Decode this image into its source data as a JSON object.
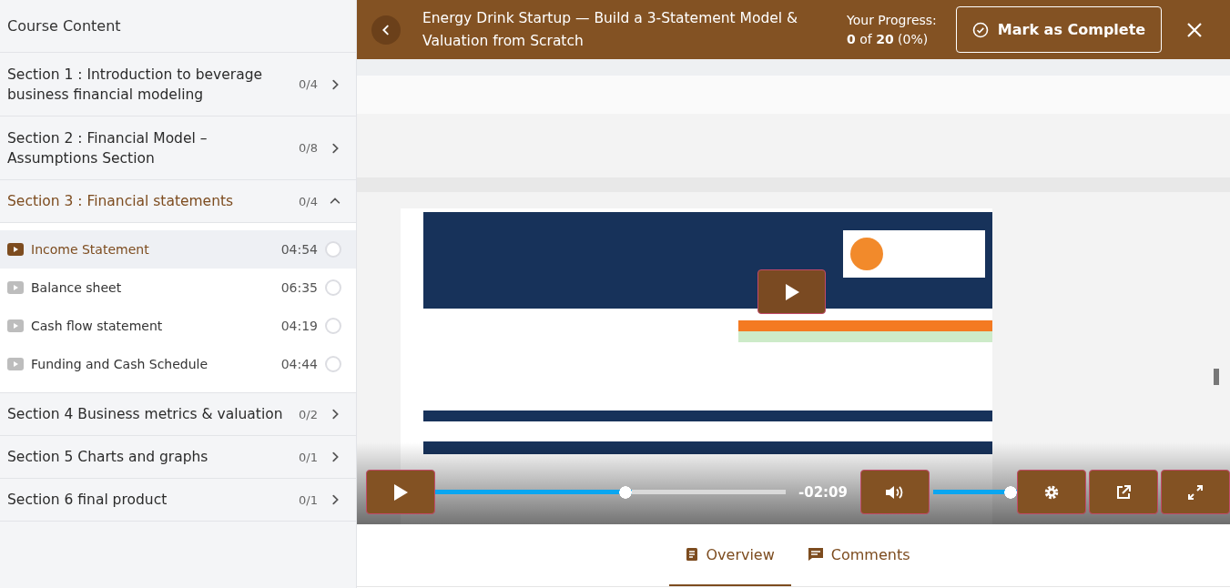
{
  "sidebar": {
    "title": "Course Content",
    "sections": [
      {
        "title": "Section 1 : Introduction to beverage business financial modeling",
        "count": "0/4",
        "expanded": false
      },
      {
        "title": "Section 2 : Financial Model – Assumptions Section",
        "count": "0/8",
        "expanded": false
      },
      {
        "title": "Section 3 : Financial statements",
        "count": "0/4",
        "expanded": true,
        "lessons": [
          {
            "title": "Income Statement",
            "duration": "04:54",
            "selected": true,
            "completed": false
          },
          {
            "title": "Balance sheet",
            "duration": "06:35",
            "selected": false,
            "completed": false
          },
          {
            "title": "Cash flow statement",
            "duration": "04:19",
            "selected": false,
            "completed": false
          },
          {
            "title": "Funding and Cash Schedule",
            "duration": "04:44",
            "selected": false,
            "completed": false
          }
        ]
      },
      {
        "title": "Section 4 Business metrics & valuation",
        "count": "0/2",
        "expanded": false
      },
      {
        "title": "Section 5 Charts and graphs",
        "count": "0/1",
        "expanded": false
      },
      {
        "title": "Section 6 final product",
        "count": "0/1",
        "expanded": false
      }
    ]
  },
  "header": {
    "title": "Energy Drink Startup — Build a 3-Statement Model & Valuation from Scratch",
    "progress_label": "Your Progress:",
    "progress": "**0** of **20** (0%)",
    "button": "Mark as Complete"
  },
  "player": {
    "seek": {
      "level": 0.56
    },
    "time": "-02:09",
    "volume": {
      "level": 1
    }
  },
  "tabs": [
    {
      "label": "Overview",
      "selected": true
    },
    {
      "label": "Comments",
      "selected": false
    }
  ]
}
